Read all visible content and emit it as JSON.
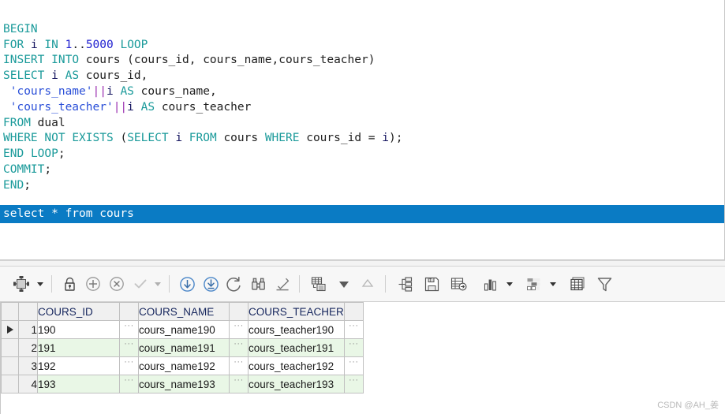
{
  "editor": {
    "code_lines": [
      "BEGIN",
      "FOR i IN 1..5000 LOOP",
      "INSERT INTO cours (cours_id, cours_name,cours_teacher)",
      "SELECT i AS cours_id,",
      " 'cours_name'||i AS cours_name,",
      " 'cours_teacher'||i AS cours_teacher",
      "FROM dual",
      "WHERE NOT EXISTS (SELECT i FROM cours WHERE cours_id = i);",
      "END LOOP;",
      "COMMIT;",
      "END;"
    ],
    "selected_line": "select * from cours",
    "colors": {
      "keyword": "#1a9a9a",
      "string": "#2a4fd8",
      "number": "#2020d0",
      "operator": "#9b30b0",
      "identifier": "#202020",
      "selection_bg": "#0a7bc4",
      "selection_fg": "#ffffff"
    }
  },
  "toolbar": {
    "items": [
      {
        "name": "single-record-view-icon",
        "label": "Single Record View",
        "has_caret": true
      },
      {
        "name": "lock-icon",
        "label": "Lock Record"
      },
      {
        "name": "plus-circle-icon",
        "label": "Insert Record"
      },
      {
        "name": "delete-circle-icon",
        "label": "Delete Record"
      },
      {
        "name": "check-icon",
        "label": "Post Changes",
        "has_caret": true,
        "disabled": true
      },
      {
        "name": "fetch-next-icon",
        "label": "Fetch Next"
      },
      {
        "name": "fetch-all-icon",
        "label": "Fetch All"
      },
      {
        "name": "refresh-icon",
        "label": "Refresh"
      },
      {
        "name": "binoculars-icon",
        "label": "Find"
      },
      {
        "name": "eraser-icon",
        "label": "Clear"
      },
      {
        "name": "grid-detail-icon",
        "label": "Single Record"
      },
      {
        "name": "triangle-down-icon",
        "label": "Move Down"
      },
      {
        "name": "triangle-up-icon",
        "label": "Move Up",
        "disabled": true
      },
      {
        "name": "hierarchy-icon",
        "label": "Hierarchy"
      },
      {
        "name": "save-text-icon",
        "label": "Export Text"
      },
      {
        "name": "export-data-icon",
        "label": "Export Data"
      },
      {
        "name": "bar-chart-icon",
        "label": "Chart",
        "has_caret": true
      },
      {
        "name": "pivot-icon",
        "label": "Pivot",
        "has_caret": true
      },
      {
        "name": "table-icon",
        "label": "Grid View"
      },
      {
        "name": "filter-funnel-icon",
        "label": "Filter"
      }
    ]
  },
  "grid": {
    "columns": [
      "COURS_ID",
      "COURS_NAME",
      "COURS_TEACHER"
    ],
    "ellipsis": "···",
    "rows": [
      {
        "num": "1",
        "current": true,
        "cells": [
          "190",
          "cours_name190",
          "cours_teacher190"
        ]
      },
      {
        "num": "2",
        "current": false,
        "cells": [
          "191",
          "cours_name191",
          "cours_teacher191"
        ]
      },
      {
        "num": "3",
        "current": false,
        "cells": [
          "192",
          "cours_name192",
          "cours_teacher192"
        ]
      },
      {
        "num": "4",
        "current": false,
        "cells": [
          "193",
          "cours_name193",
          "cours_teacher193"
        ]
      }
    ]
  },
  "watermark": {
    "text": "CSDN @AH_姜"
  }
}
